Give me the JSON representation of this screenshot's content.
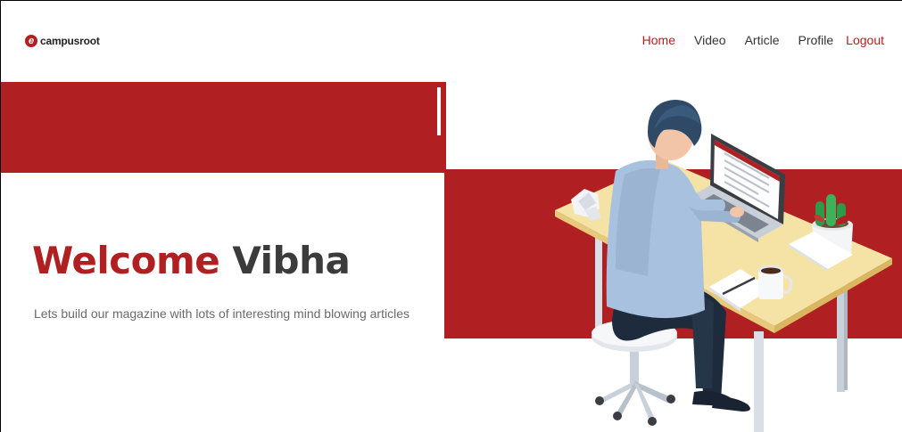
{
  "brand": {
    "logo_letter": "e",
    "name": "campusroot"
  },
  "nav": {
    "items": [
      {
        "label": "Home",
        "active": true
      },
      {
        "label": "Video",
        "active": false
      },
      {
        "label": "Article",
        "active": false
      },
      {
        "label": "Profile",
        "active": false
      }
    ],
    "logout_label": "Logout"
  },
  "hero": {
    "greeting": "Welcome",
    "user_name": "Vibha",
    "subtitle": "Lets build our magazine with lots of interesting mind blowing articles"
  },
  "illustration": {
    "icon": "person-at-desk-illustration"
  },
  "colors": {
    "accent": "#b01f21",
    "text_dark": "#3b3b3b",
    "text_muted": "#6a6a6a"
  }
}
